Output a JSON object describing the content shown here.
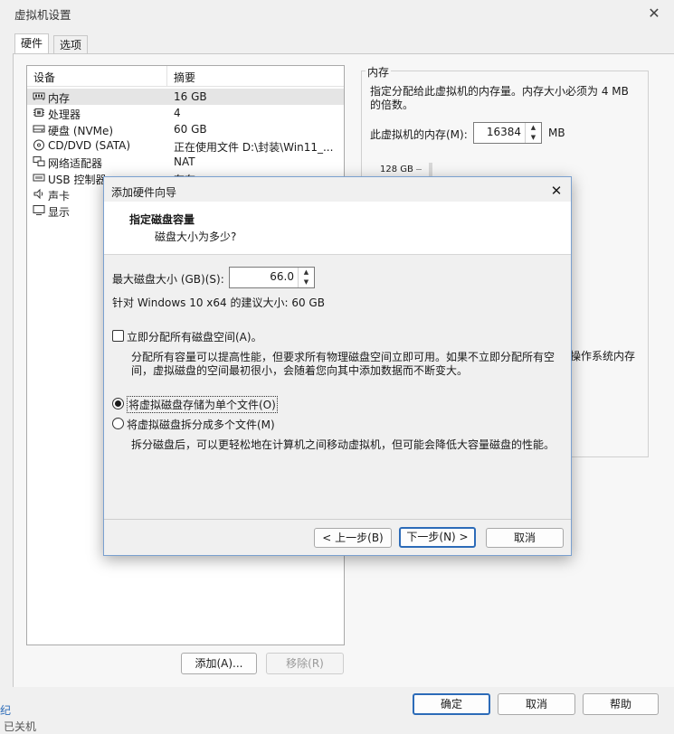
{
  "window": {
    "title": "虚拟机设置"
  },
  "tabs": [
    {
      "label": "硬件"
    },
    {
      "label": "选项"
    }
  ],
  "device_table": {
    "columns": [
      "设备",
      "摘要"
    ],
    "rows": [
      {
        "device": "内存",
        "summary": "16 GB",
        "icon": "memory-icon"
      },
      {
        "device": "处理器",
        "summary": "4",
        "icon": "cpu-icon"
      },
      {
        "device": "硬盘 (NVMe)",
        "summary": "60 GB",
        "icon": "harddisk-icon"
      },
      {
        "device": "CD/DVD (SATA)",
        "summary": "正在使用文件 D:\\封装\\Win11_...",
        "icon": "cd-icon"
      },
      {
        "device": "网络适配器",
        "summary": "NAT",
        "icon": "network-icon"
      },
      {
        "device": "USB 控制器",
        "summary": "存在",
        "icon": "usb-icon"
      },
      {
        "device": "声卡",
        "summary": "",
        "icon": "speaker-icon"
      },
      {
        "device": "显示",
        "summary": "",
        "icon": "monitor-icon"
      }
    ],
    "add_button": "添加(A)...",
    "remove_button": "移除(R)"
  },
  "memory_panel": {
    "group_title": "内存",
    "desc_line1": "指定分配给此虚拟机的内存量。内存大小必须为 4 MB",
    "desc_line2": "的倍数。",
    "vm_memory_label": "此虚拟机的内存(M):",
    "vm_memory_value": "16384",
    "unit": "MB",
    "scale_top": "128 GB",
    "partial_text": "操作系统内存"
  },
  "footer": {
    "ok": "确定",
    "cancel": "取消",
    "help": "帮助"
  },
  "bottom_left": {
    "char1": "纪",
    "text2": "已关机"
  },
  "wizard": {
    "title": "添加硬件向导",
    "heading": "指定磁盘容量",
    "subheading": "磁盘大小为多少?",
    "max_size_label": "最大磁盘大小 (GB)(S):",
    "max_size_value": "66.0",
    "recommended": "针对 Windows 10 x64 的建议大小: 60 GB",
    "allocate_now_label": "立即分配所有磁盘空间(A)。",
    "allocate_now_checked": false,
    "allocate_desc_line1": "分配所有容量可以提高性能，但要求所有物理磁盘空间立即可用。如果不立即分配所有空",
    "allocate_desc_line2": "间，虚拟磁盘的空间最初很小，会随着您向其中添加数据而不断变大。",
    "single_file_label": "将虚拟磁盘存储为单个文件(O)",
    "single_file_selected": true,
    "split_files_label": "将虚拟磁盘拆分成多个文件(M)",
    "split_desc": "拆分磁盘后，可以更轻松地在计算机之间移动虚拟机，但可能会降低大容量磁盘的性能。",
    "back_button": "< 上一步(B)",
    "next_button": "下一步(N) >",
    "cancel_button": "取消"
  }
}
